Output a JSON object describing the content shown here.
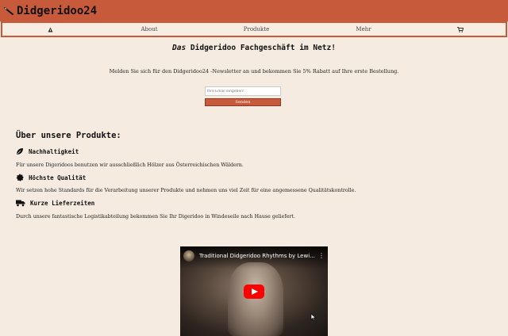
{
  "header": {
    "brand": "Didgeridoo24",
    "logo_icon": "didgeridoo-icon",
    "background": "#c85a3c"
  },
  "nav": {
    "home_icon": "home-triangle-icon",
    "about": "About",
    "products": "Produkte",
    "more": "Mehr",
    "cart_icon": "shopping-cart-icon"
  },
  "hero": {
    "headline_em": "Das",
    "headline_rest": " Didgeridoo Fachgeschäft im Netz!"
  },
  "newsletter": {
    "text": "Melden Sie sich für den Didgeridoo24 -Newsletter an und bekommen Sie 5% Rabatt auf Ihre erste Bestellung.",
    "email_placeholder": "Ihre Email eingeben!",
    "send_label": "Senden"
  },
  "products": {
    "title": "Über unsere Produkte:",
    "features": [
      {
        "icon": "leaf-icon",
        "title": "Nachhaltigkeit",
        "text": "Für unsere Digeridoos benutzen wir ausschließlich Hölzer aus Österreichischen Wäldern."
      },
      {
        "icon": "certificate-icon",
        "title": "Höchste Qualität",
        "text": "Wir setzen hohe Standards für die Verarbeitung unserer Produkte und nehmen uns viel Zeit für eine angemessene Qualitätskontrolle."
      },
      {
        "icon": "truck-icon",
        "title": "Kurze Lieferzeiten",
        "text": "Durch unsere fantastische Logistikabteilung bekommen Sie Ihr Digeridoo in Windeseile nach Hause geliefert."
      }
    ]
  },
  "video": {
    "title": "Traditional Didgeridoo Rhythms by Lewi...",
    "menu_icon": "more-vertical-icon",
    "play_icon": "youtube-play-icon"
  }
}
